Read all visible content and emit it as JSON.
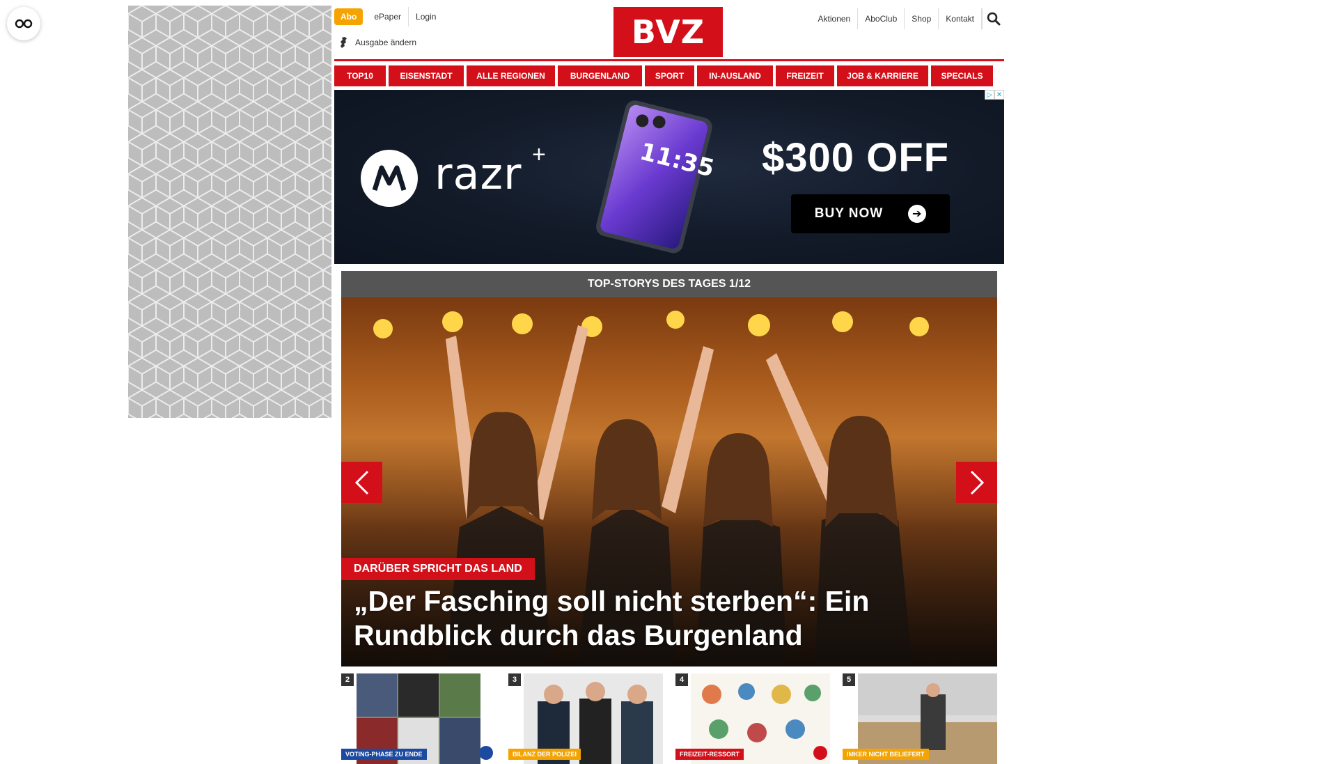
{
  "header": {
    "abo_label": "Abo",
    "epaper_label": "ePaper",
    "login_label": "Login",
    "ausgabe_label": "Ausgabe ändern",
    "logo_text": "BVZ",
    "right_links": [
      "Aktionen",
      "AboClub",
      "Shop",
      "Kontakt"
    ]
  },
  "nav": {
    "items": [
      "TOP10",
      "EISENSTADT",
      "ALLE REGIONEN",
      "BURGENLAND",
      "SPORT",
      "IN-AUSLAND",
      "FREIZEIT",
      "JOB & KARRIERE",
      "SPECIALS"
    ]
  },
  "ad": {
    "brand": "razr",
    "brand_suffix": "+",
    "phone_time": "11:35",
    "offer": "$300 OFF",
    "cta": "BUY NOW",
    "colors": {
      "background": "#121a28",
      "cta": "#000000"
    }
  },
  "top_stories": {
    "header": "TOP-STORYS DES TAGES 1/12",
    "hero": {
      "tag": "DARÜBER SPRICHT DAS LAND",
      "title": "„Der Fasching soll nicht sterben“: Ein Rundblick durch das Burgenland"
    },
    "thumbs": [
      {
        "num": "2",
        "tag": "VOTING-PHASE ZU ENDE",
        "tag_color": "#1b4aa0",
        "badge_color": "#1b4aa0"
      },
      {
        "num": "3",
        "tag": "BILANZ DER POLIZEI",
        "tag_color": "#f4a300",
        "badge_color": ""
      },
      {
        "num": "4",
        "tag": "FREIZEIT-RESSORT",
        "tag_color": "#d3101a",
        "badge_color": "#d3101a"
      },
      {
        "num": "5",
        "tag": "IMKER NICHT BELIEFERT",
        "tag_color": "#f4a300",
        "badge_color": ""
      }
    ]
  },
  "colors": {
    "brand_red": "#d3101a",
    "abo_orange": "#f4a300",
    "story_header": "#555555"
  }
}
